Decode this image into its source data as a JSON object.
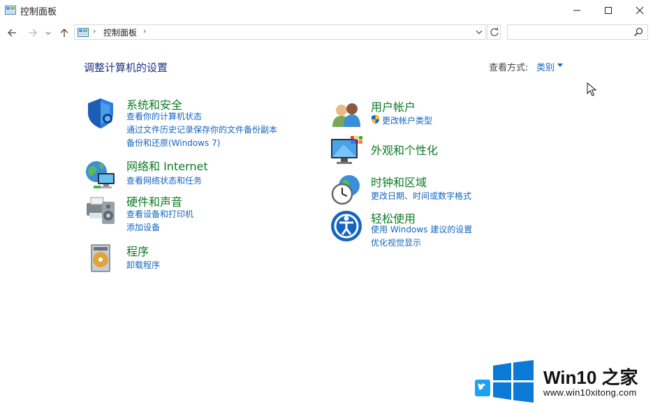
{
  "window": {
    "title": "控制面板",
    "icon": "control-panel-icon",
    "controls": [
      "minimize-icon",
      "maximize-icon",
      "close-icon"
    ]
  },
  "nav": {
    "address_path": "控制面板",
    "separator": "›",
    "search_placeholder": "",
    "icons": [
      "back-arrow-icon",
      "forward-arrow-icon",
      "recent-dropdown-icon",
      "up-arrow-icon",
      "refresh-icon",
      "search-icon"
    ]
  },
  "header": {
    "title": "调整计算机的设置",
    "view_by_label": "查看方式:",
    "view_by_value": "类别"
  },
  "categories": {
    "system_security": {
      "title": "系统和安全",
      "links": [
        "查看你的计算机状态",
        "通过文件历史记录保存你的文件备份副本",
        "备份和还原(Windows 7)"
      ]
    },
    "network": {
      "title": "网络和 Internet",
      "links": [
        "查看网络状态和任务"
      ]
    },
    "hardware": {
      "title": "硬件和声音",
      "links": [
        "查看设备和打印机",
        "添加设备"
      ]
    },
    "programs": {
      "title": "程序",
      "links": [
        "卸载程序"
      ]
    },
    "user_accounts": {
      "title": "用户帐户",
      "links": [
        "更改帐户类型"
      ]
    },
    "appearance": {
      "title": "外观和个性化",
      "links": []
    },
    "clock_region": {
      "title": "时钟和区域",
      "links": [
        "更改日期、时间或数字格式"
      ]
    },
    "ease_of_access": {
      "title": "轻松使用",
      "links": [
        "使用 Windows 建议的设置",
        "优化视觉显示"
      ]
    }
  },
  "watermark": {
    "brand": "Win10 之家",
    "url": "www.win10xitong.com"
  },
  "colors": {
    "category_title": "#0d7a25",
    "link": "#1565c0",
    "page_title": "#1e3287",
    "windows_blue": "#0a7ad6"
  }
}
